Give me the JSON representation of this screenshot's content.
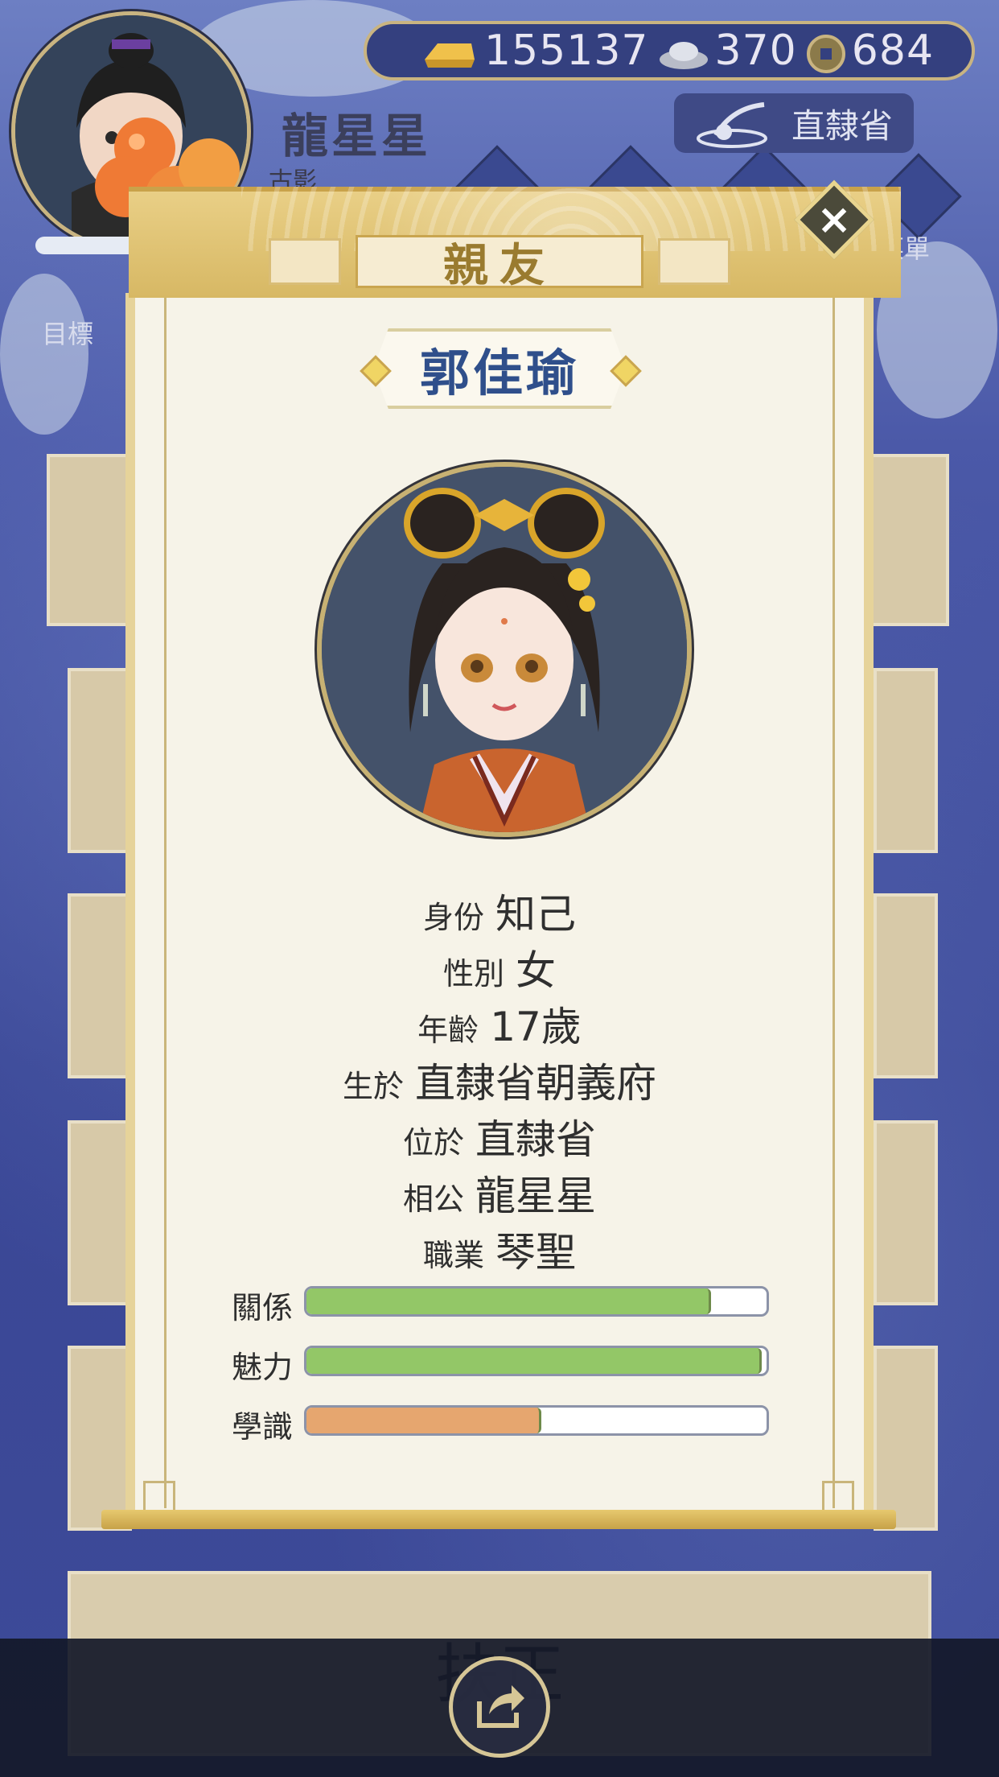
{
  "header": {
    "player_name": "龍星星",
    "subtitle": "古影",
    "location": "直隸省",
    "menu_label": "菜單",
    "goal_label": "目標",
    "currency": {
      "gold": "155137",
      "silver": "370",
      "coins": "684"
    }
  },
  "modal": {
    "title": "親友",
    "close_label": "×",
    "character_name": "郭佳瑜",
    "info": [
      {
        "label": "身份",
        "value": "知己"
      },
      {
        "label": "性別",
        "value": "女"
      },
      {
        "label": "年齡",
        "value": "17歲"
      },
      {
        "label": "生於",
        "value": "直隸省朝義府"
      },
      {
        "label": "位於",
        "value": "直隸省"
      },
      {
        "label": "相公",
        "value": "龍星星"
      },
      {
        "label": "職業",
        "value": "琴聖"
      }
    ],
    "stats": [
      {
        "label": "關係",
        "fraction": 0.88,
        "color": "#93c767"
      },
      {
        "label": "魅力",
        "fraction": 0.99,
        "color": "#93c767"
      },
      {
        "label": "學識",
        "fraction": 0.51,
        "color": "#e6a66f"
      }
    ]
  },
  "background": {
    "bottom_card_text": "扶正"
  },
  "icons": {
    "gold": "gold-bar-icon",
    "silver": "silver-ingot-icon",
    "coin": "copper-coin-icon",
    "location": "seal-stamp-icon",
    "share": "share-icon",
    "close": "close-icon"
  }
}
